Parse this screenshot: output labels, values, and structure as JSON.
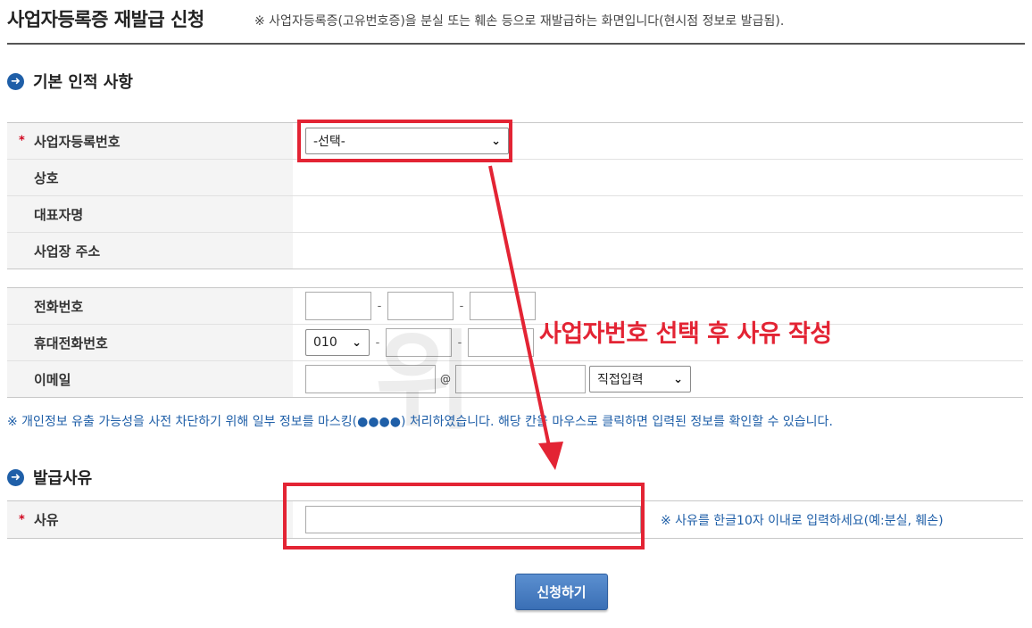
{
  "header": {
    "title": "사업자등록증 재발급 신청",
    "description": "※ 사업자등록증(고유번호증)을 분실 또는 훼손 등으로 재발급하는 화면입니다(현시점 정보로 발급됨)."
  },
  "basic_info": {
    "section_title": "기본 인적 사항",
    "rows": {
      "business_number": {
        "label": "사업자등록번호",
        "select_value": "-선택-"
      },
      "trade_name": {
        "label": "상호"
      },
      "representative": {
        "label": "대표자명"
      },
      "business_address": {
        "label": "사업장 주소"
      }
    },
    "contact": {
      "phone": {
        "label": "전화번호"
      },
      "mobile": {
        "label": "휴대전화번호",
        "prefix_value": "010"
      },
      "email": {
        "label": "이메일",
        "at_sign": "@",
        "domain_select": "직접입력"
      }
    },
    "dash": "-"
  },
  "notice": "※ 개인정보 유출 가능성을 사전 차단하기 위해 일부 정보를 마스킹(●●●●) 처리하였습니다. 해당 칸을 마우스로 클릭하면 입력된 정보를 확인할 수 있습니다.",
  "reason_section": {
    "section_title": "발급사유",
    "label": "사유",
    "hint": "※ 사유를 한글10자 이내로 입력하세요(예:분실, 훼손)"
  },
  "submit_label": "신청하기",
  "annotation": {
    "text": "사업자번호 선택 후 사유 작성",
    "color": "#e32434"
  },
  "required_mark": "*",
  "watermark": "위"
}
